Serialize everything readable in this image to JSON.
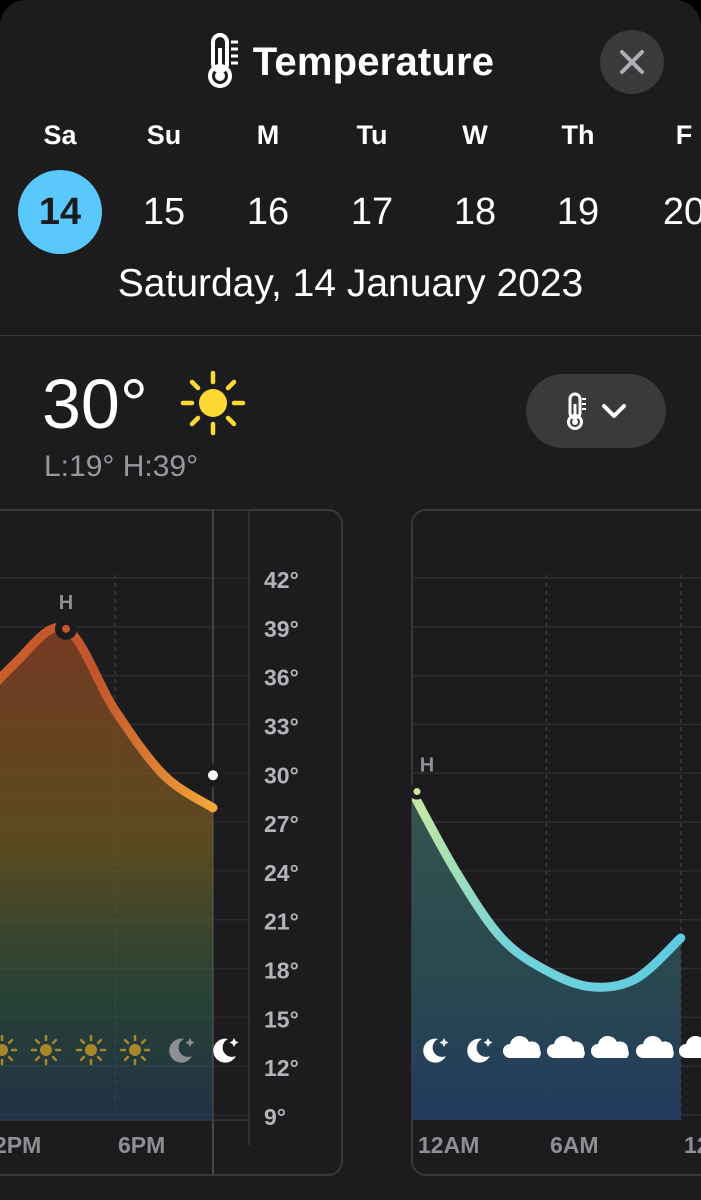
{
  "header": {
    "title": "Temperature",
    "title_icon": "thermometer-icon",
    "close_icon": "xmark-icon"
  },
  "week": [
    {
      "abbr": "Sa",
      "num": "14",
      "selected": true
    },
    {
      "abbr": "Su",
      "num": "15",
      "selected": false
    },
    {
      "abbr": "M",
      "num": "16",
      "selected": false
    },
    {
      "abbr": "Tu",
      "num": "17",
      "selected": false
    },
    {
      "abbr": "W",
      "num": "18",
      "selected": false
    },
    {
      "abbr": "Th",
      "num": "19",
      "selected": false
    },
    {
      "abbr": "F",
      "num": "20",
      "selected": false
    }
  ],
  "selected_date": "Saturday, 14 January 2023",
  "current": {
    "temp": "30°",
    "condition_icon": "sun-icon",
    "low_high": "L:19° H:39°"
  },
  "metric_menu": {
    "icon": "thermometer-icon",
    "chevron": "chevron-down-icon"
  },
  "chart_data": [
    {
      "type": "line",
      "day": "Saturday",
      "x_labels": [
        "2PM",
        "6PM"
      ],
      "x_hours": [
        10,
        12,
        14,
        16,
        18,
        20,
        22
      ],
      "values": [
        24,
        33,
        37,
        39,
        34,
        30,
        28
      ],
      "y_ticks": [
        "42°",
        "39°",
        "36°",
        "33°",
        "30°",
        "27°",
        "24°",
        "21°",
        "18°",
        "15°",
        "12°",
        "9°"
      ],
      "ylim": [
        9,
        42
      ],
      "high_marker": {
        "label": "H",
        "hour": 16,
        "value": 39
      },
      "current_marker": {
        "hour": 20,
        "value": 30
      },
      "hour_icons": [
        "sun-icon",
        "sun-icon",
        "sun-icon",
        "sun-icon",
        "sun-icon",
        "moon-stars-icon",
        "moon-stars-icon"
      ],
      "colors": {
        "line": "#f0a040",
        "line_hot": "#c95a2a"
      }
    },
    {
      "type": "line",
      "day": "Sunday",
      "x_labels": [
        "12AM",
        "6AM",
        "12"
      ],
      "x_hours": [
        0,
        2,
        4,
        6,
        8,
        10,
        12
      ],
      "values": [
        29,
        24,
        20,
        18,
        17,
        17.5,
        20
      ],
      "y_ticks": [
        "42°",
        "39°",
        "36°",
        "33°",
        "30°",
        "27°",
        "24°",
        "21°",
        "18°",
        "15°",
        "12°",
        "9°"
      ],
      "ylim": [
        9,
        42
      ],
      "high_marker": {
        "label": "H",
        "hour": 0,
        "value": 29
      },
      "hour_icons": [
        "moon-stars-icon",
        "moon-stars-icon",
        "cloud-icon",
        "cloud-icon",
        "cloud-icon",
        "cloud-icon",
        "cloud-icon"
      ],
      "colors": {
        "line": "#6ad3e0",
        "line_warm": "#bde39b"
      }
    }
  ]
}
